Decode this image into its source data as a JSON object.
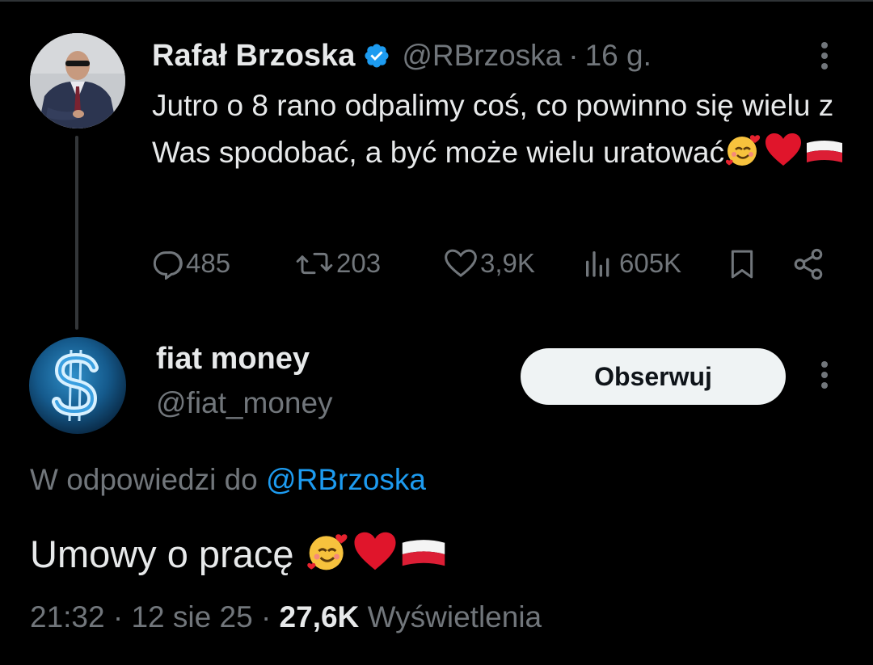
{
  "parent_tweet": {
    "author_name": "Rafał Brzoska",
    "handle": "@RBrzoska",
    "separator": "·",
    "time_ago": "16 g.",
    "text": "Jutro o 8 rano odpalimy coś, co powinno się wielu z Was spodobać, a być może wielu uratować",
    "emojis": [
      "smiling-face-with-hearts",
      "red-heart",
      "flag-poland"
    ],
    "actions": {
      "replies": "485",
      "reposts": "203",
      "likes": "3,9K",
      "views": "605K"
    }
  },
  "reply_tweet": {
    "author_name": "fiat money",
    "handle": "@fiat_money",
    "follow_label": "Obserwuj",
    "replying_prefix": "W odpowiedzi do",
    "replying_to": "@RBrzoska",
    "text": "Umowy o pracę",
    "emojis": [
      "smiling-face-with-hearts",
      "red-heart",
      "flag-poland"
    ],
    "time": "21:32",
    "date": "12 sie 25",
    "views_count": "27,6K",
    "views_label": "Wyświetlenia",
    "separator": "·"
  },
  "colors": {
    "background": "#000000",
    "text_primary": "#e7e9ea",
    "text_secondary": "#71767b",
    "accent": "#1d9bf0",
    "follow_button_bg": "#eff3f4"
  }
}
